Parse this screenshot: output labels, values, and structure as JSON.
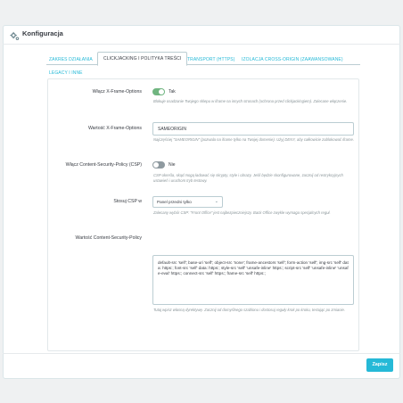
{
  "header": {
    "title": "Konfiguracja"
  },
  "tabs": [
    {
      "label": "ZAKRES DZIAŁANIA",
      "active": false
    },
    {
      "label": "CLICKJACKING I POLITYKA TREŚCI",
      "active": true
    },
    {
      "label": "TRANSPORT (HTTPS)",
      "active": false
    },
    {
      "label": "IZOLACJA CROSS-ORIGIN (ZAAWANSOWANE)",
      "active": false
    },
    {
      "label": "LEGACY I INNE",
      "active": false
    }
  ],
  "form": {
    "xframe": {
      "label": "Włącz X-Frame-Options",
      "toggle_text": "Tak",
      "enabled": true,
      "help": "Blokuje osadzanie Twojego sklepu w iframe na innych stronach (ochrona przed clickjackingiem). Zalecane włączenie."
    },
    "xframe_value": {
      "label": "Wartość X-Frame-Options",
      "value": "SAMEORIGIN",
      "help": "Najczęściej \"SAMEORIGIN\" (pozwala na iframe tylko na Twojej domenie). Użyj DENY, aby całkowicie zablokować iframe."
    },
    "csp": {
      "label": "Włącz Content-Security-Policy (CSP)",
      "toggle_text": "Nie",
      "enabled": false,
      "help": "CSP określa, skąd mogą ładować się skrypty, style i obrazy. Jeśli będzie skonfigurowane, zacznij od restrykcyjnych ustawień i uruchom tryb testowy."
    },
    "csp_apply": {
      "label": "Stosuj CSP w",
      "selected": "Panel przedni tylko",
      "help": "Zalecany wybór CSP: \"Front Office\" jest najbezpieczniejszy. Back Office zwykle wymaga specjalnych reguł."
    },
    "csp_value": {
      "label": "Wartość Content-Security-Policy",
      "value": "default-src 'self'; base-uri 'self'; object-src 'none'; frame-ancestors 'self'; form-action 'self'; img-src 'self' data: https:; font-src 'self' data: https:; style-src 'self' 'unsafe-inline' https:; script-src 'self' 'unsafe-inline' 'unsafe-eval' https:; connect-src 'self' https:; frame-src 'self' https:;",
      "help": "Tutaj wpisz własną dyrektywę. Zacznij od domyślnego szablonu i dostosuj reguły krok po kroku, testując po zmianie."
    }
  },
  "footer": {
    "save_label": "Zapisz"
  },
  "colors": {
    "accent": "#25b9d7",
    "toggle_on": "#70b580",
    "toggle_off": "#8f9aa0"
  },
  "icons": {
    "header": "gears-icon",
    "select": "chevron-down-icon"
  }
}
